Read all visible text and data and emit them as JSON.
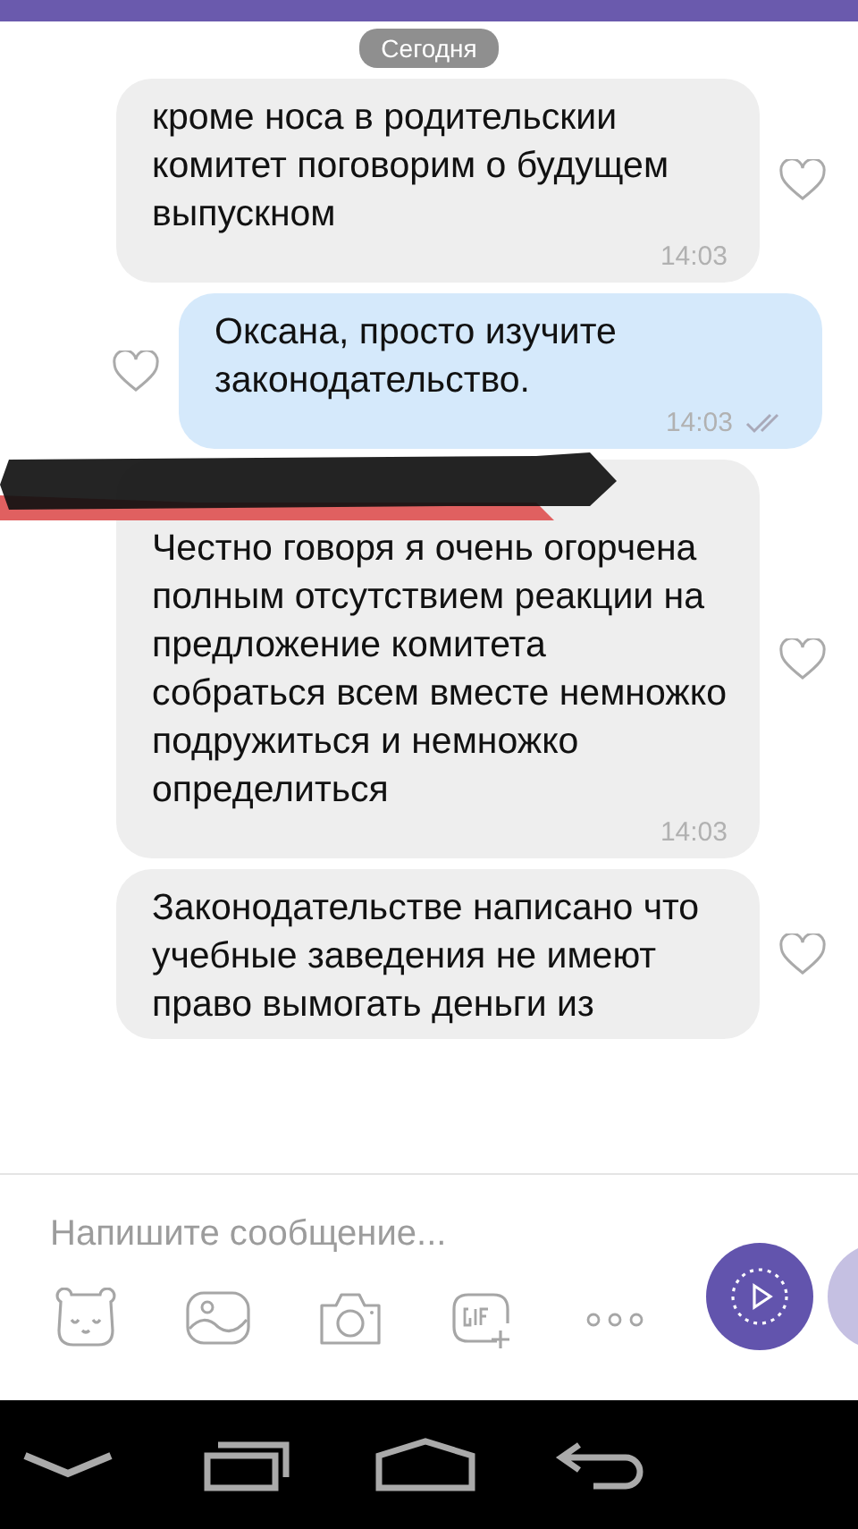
{
  "date_chip": "Сегодня",
  "messages": [
    {
      "kind": "incoming",
      "text": "кроме носа в родительскии комитет поговорим о будущем выпускном",
      "time": "14:03",
      "liked": false,
      "sender_hidden": false
    },
    {
      "kind": "outgoing",
      "text": "Оксана, просто изучите законодательство.",
      "time": "14:03",
      "liked": false,
      "read": true
    },
    {
      "kind": "incoming",
      "text": "Честно говоря я очень огорчена полным отсутствием реакции на предложение комитета собраться всем вместе немножко подружиться и немножко определиться",
      "time": "14:03",
      "liked": false,
      "sender_hidden": true
    },
    {
      "kind": "incoming",
      "text": "Законодательстве написано что учебные заведения не имеют право вымогать деньги из",
      "liked": false,
      "sender_hidden": false
    }
  ],
  "composer": {
    "placeholder": "Напишите сообщение..."
  }
}
